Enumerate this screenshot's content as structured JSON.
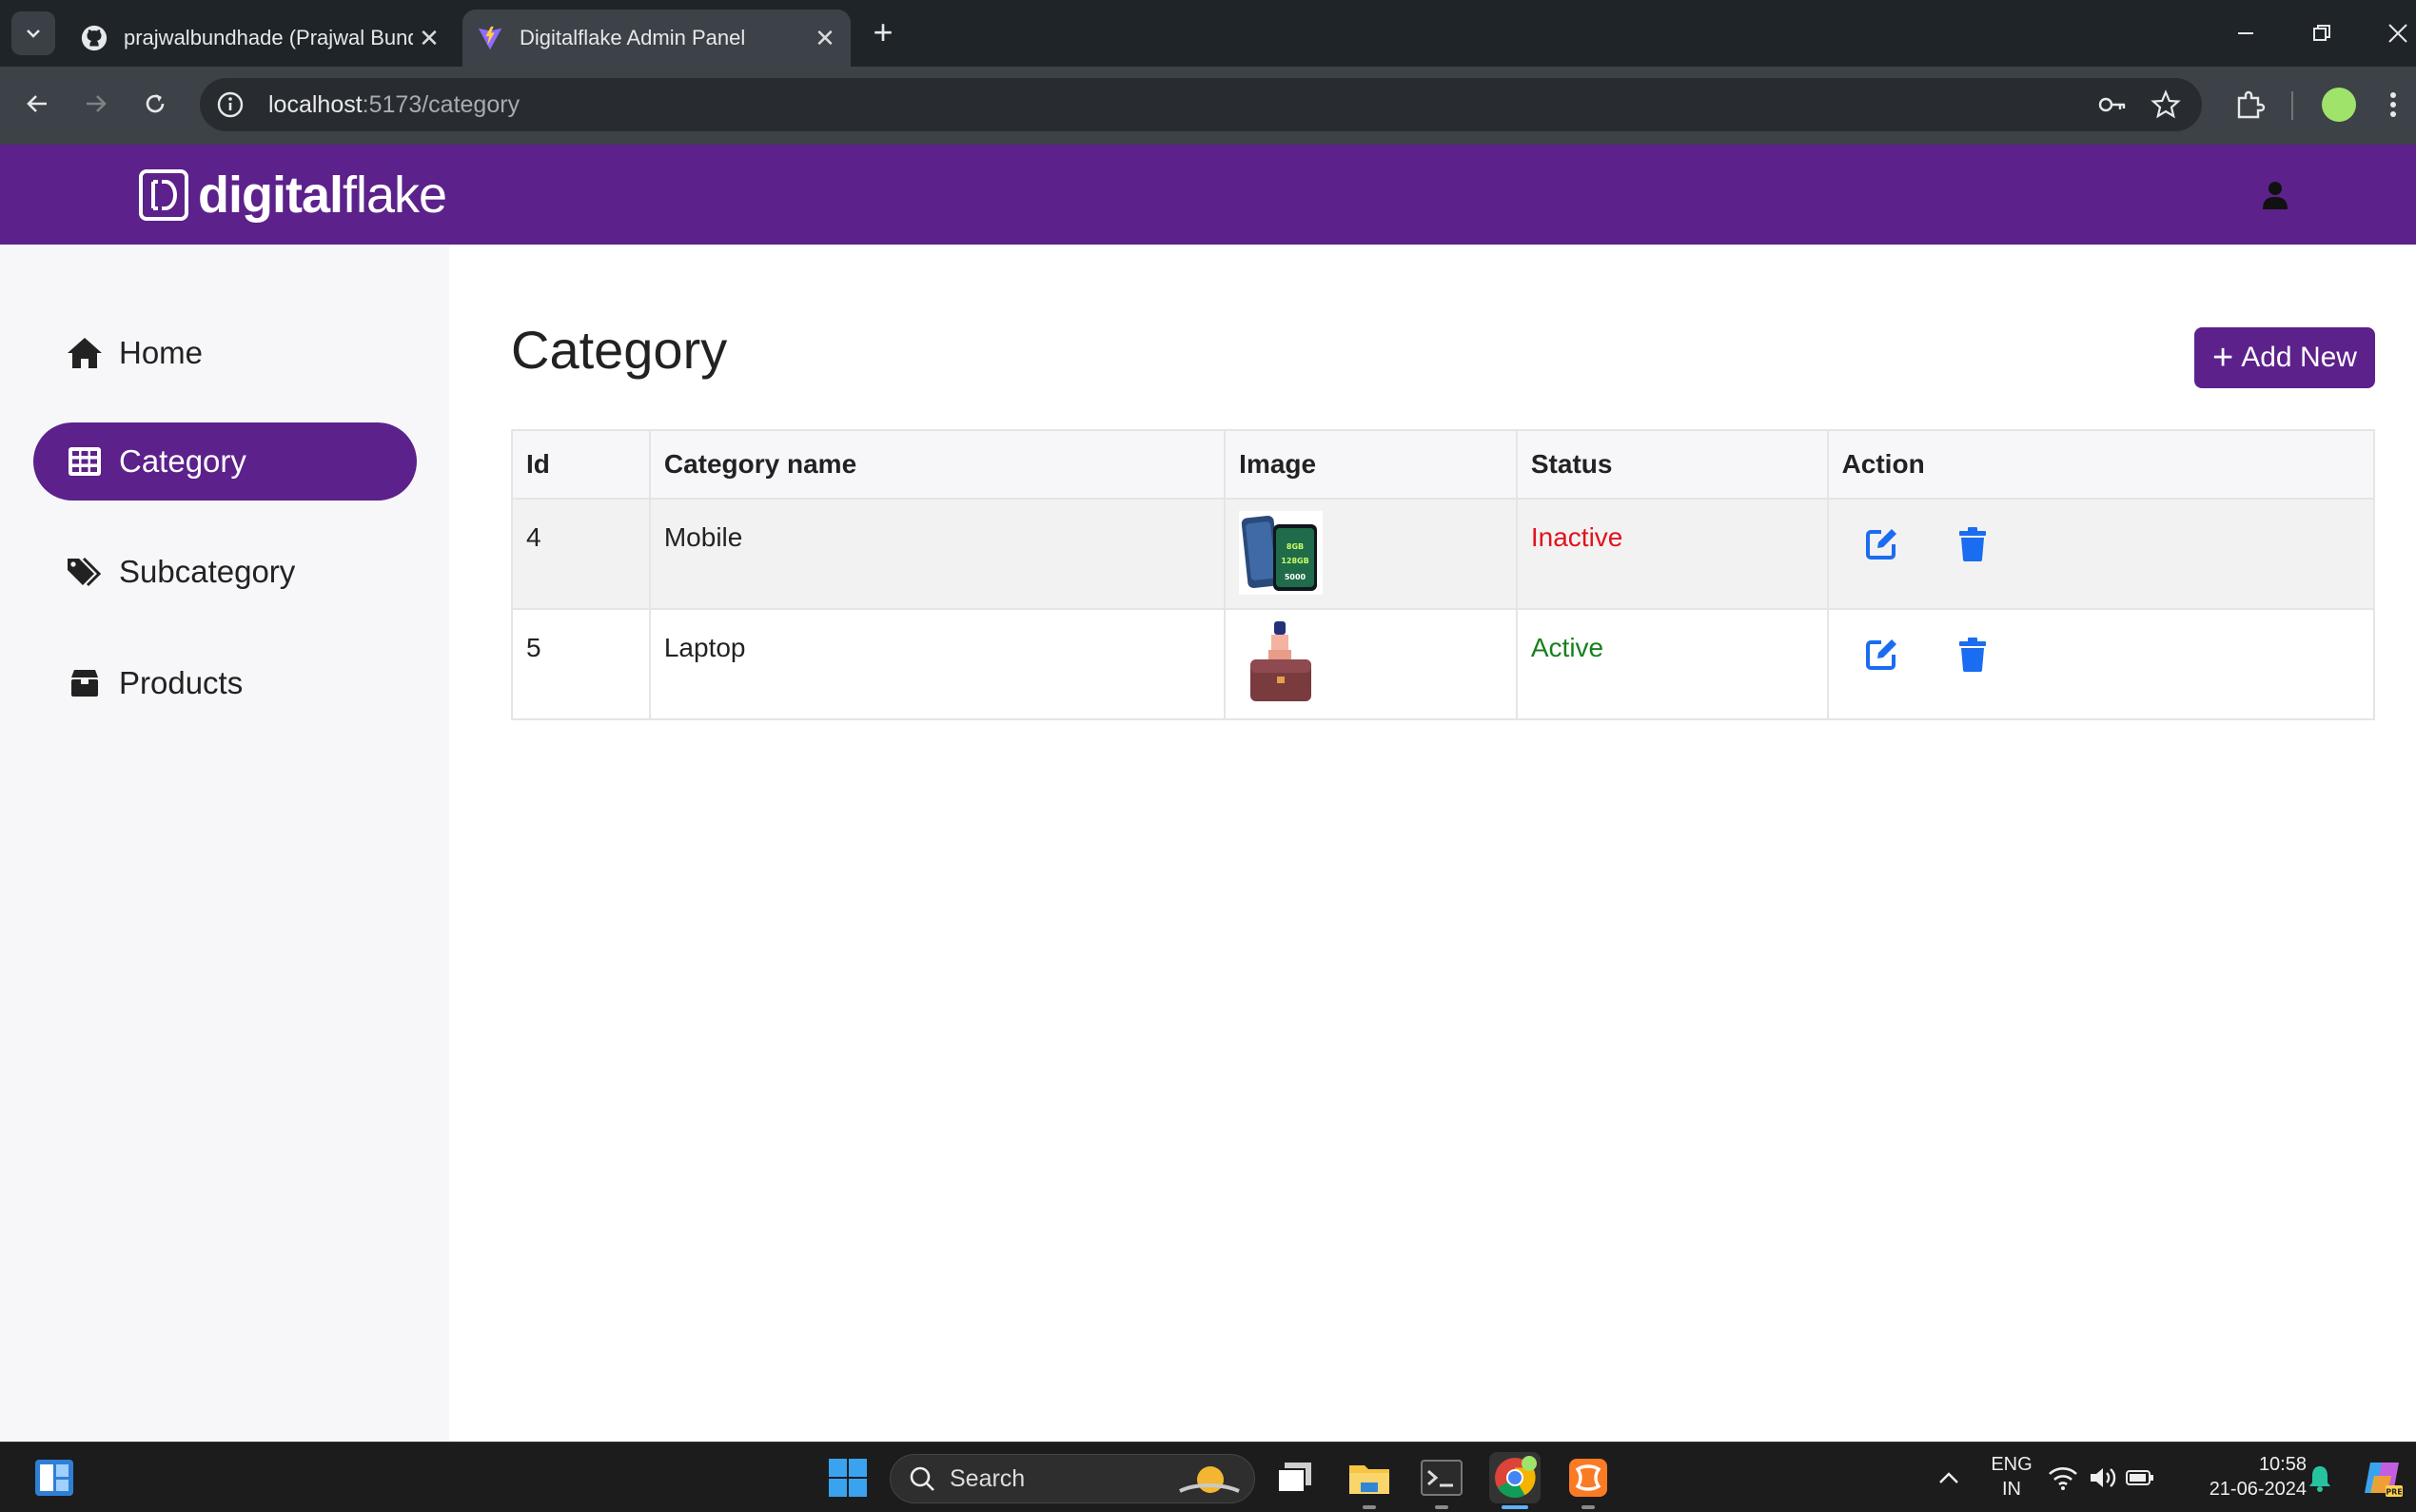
{
  "browser": {
    "tabs": [
      {
        "title": "prajwalbundhade (Prajwal Bundhade)",
        "active": false,
        "icon": "github-icon"
      },
      {
        "title": "Digitalflake Admin Panel",
        "active": true,
        "icon": "vite-icon"
      }
    ],
    "url_host": "localhost",
    "url_path": ":5173/category"
  },
  "app": {
    "logo_bold": "digital",
    "logo_light": "flake"
  },
  "sidebar": {
    "items": [
      {
        "label": "Home",
        "icon": "home-icon",
        "active": false
      },
      {
        "label": "Category",
        "icon": "grid-icon",
        "active": true
      },
      {
        "label": "Subcategory",
        "icon": "tags-icon",
        "active": false
      },
      {
        "label": "Products",
        "icon": "box-icon",
        "active": false
      }
    ]
  },
  "main": {
    "title": "Category",
    "add_button": "Add New",
    "add_button_icon": "+",
    "table": {
      "headers": [
        "Id",
        "Category name",
        "Image",
        "Status",
        "Action"
      ],
      "rows": [
        {
          "id": "4",
          "name": "Mobile",
          "image": "mobile-thumbnail",
          "status": "Inactive"
        },
        {
          "id": "5",
          "name": "Laptop",
          "image": "laptop-bag-thumbnail",
          "status": "Active"
        }
      ]
    }
  },
  "taskbar": {
    "search_placeholder": "Search",
    "lang_line1": "ENG",
    "lang_line2": "IN",
    "time": "10:58",
    "date": "21-06-2024"
  },
  "colors": {
    "brand": "#5c218b",
    "inactive": "#e0141e",
    "active": "#17801f",
    "action_blue": "#1a6df0"
  }
}
